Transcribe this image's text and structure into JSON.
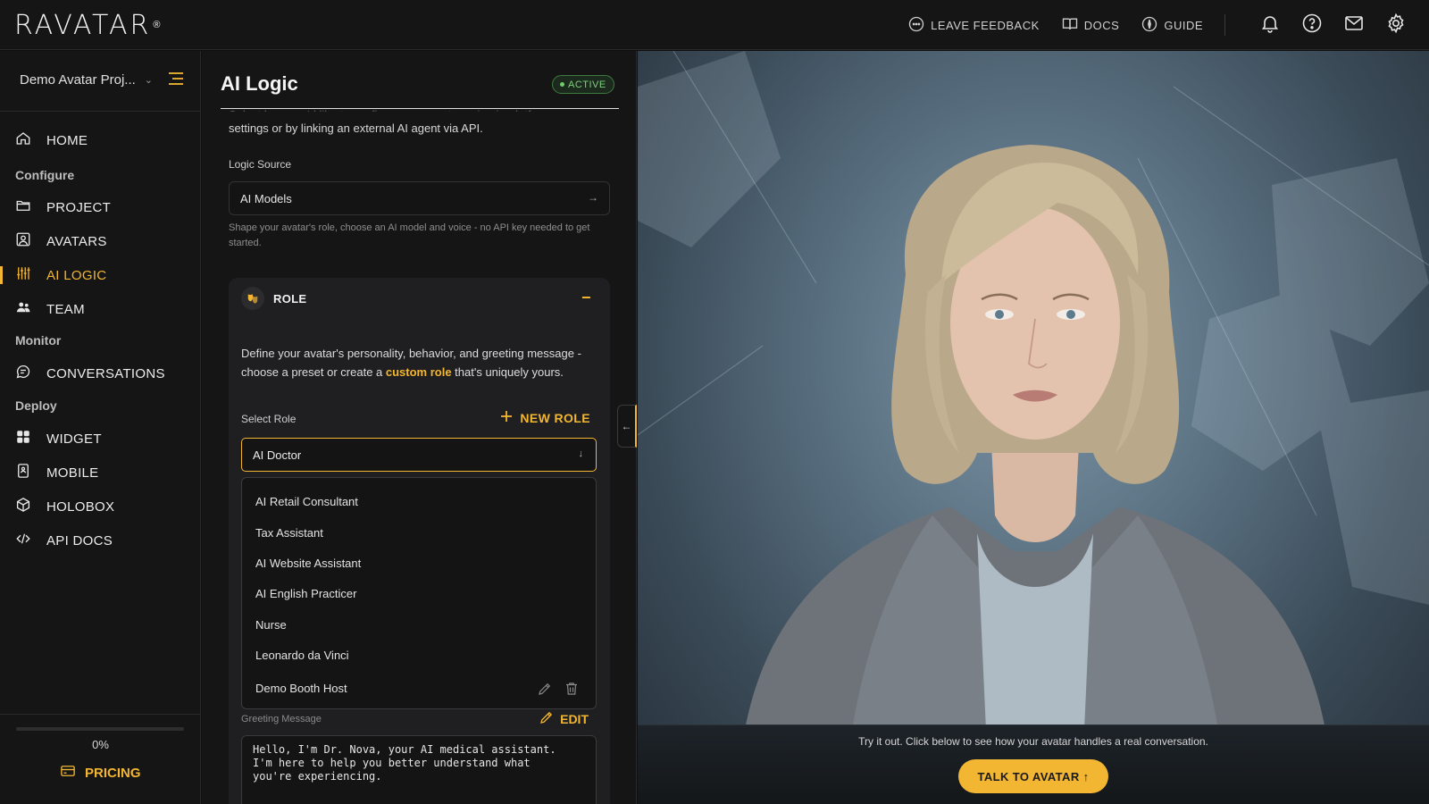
{
  "app": {
    "logo_text": "RAVATAR",
    "logo_mark": "®"
  },
  "topbar": {
    "feedback_label": "LEAVE FEEDBACK",
    "docs_label": "DOCS",
    "guide_label": "GUIDE"
  },
  "sidebar": {
    "project_name": "Demo Avatar Proj...",
    "home": "HOME",
    "section_configure": "Configure",
    "project": "PROJECT",
    "avatars": "AVATARS",
    "ai_logic": "AI LOGIC",
    "team": "TEAM",
    "section_monitor": "Monitor",
    "conversations": "CONVERSATIONS",
    "section_deploy": "Deploy",
    "widget": "WIDGET",
    "mobile": "MOBILE",
    "holobox": "HOLOBOX",
    "api_docs": "API DOCS",
    "progress_text": "0%",
    "progress_value": 0,
    "pricing": "PRICING"
  },
  "panel": {
    "title": "AI Logic",
    "status_badge": "ACTIVE",
    "description_clipped": "Select how you'd like to configure your avatar using in-platform",
    "description": "settings or by linking an external AI agent via API.",
    "logic_source_label": "Logic Source",
    "logic_source_value": "AI Models",
    "logic_source_helper": "Shape your avatar's role, choose an AI model and voice - no API key needed to get started.",
    "role": {
      "title": "ROLE",
      "desc_before": "Define your avatar's personality, behavior, and greeting message - choose a preset or create a ",
      "desc_highlight": "custom role",
      "desc_after": " that's uniquely yours.",
      "select_label": "Select Role",
      "new_role": "NEW ROLE",
      "selected": "AI Doctor",
      "options": [
        "AI Retail Consultant",
        "Tax Assistant",
        "AI Website Assistant",
        "AI English Practicer",
        "Nurse",
        "Leonardo da Vinci",
        "Demo Booth Host"
      ],
      "greeting_label": "Greeting Message",
      "edit": "EDIT",
      "greeting_text": "Hello, I'm Dr. Nova, your AI medical assistant.\nI'm here to help you better understand what\nyou're experiencing."
    }
  },
  "stage": {
    "try_text": "Try it out. Click below to see how your avatar handles a real conversation.",
    "talk_button": "TALK TO AVATAR ↑"
  },
  "colors": {
    "accent": "#f2b632",
    "background": "#151516",
    "active_green": "#6ccf6c"
  }
}
